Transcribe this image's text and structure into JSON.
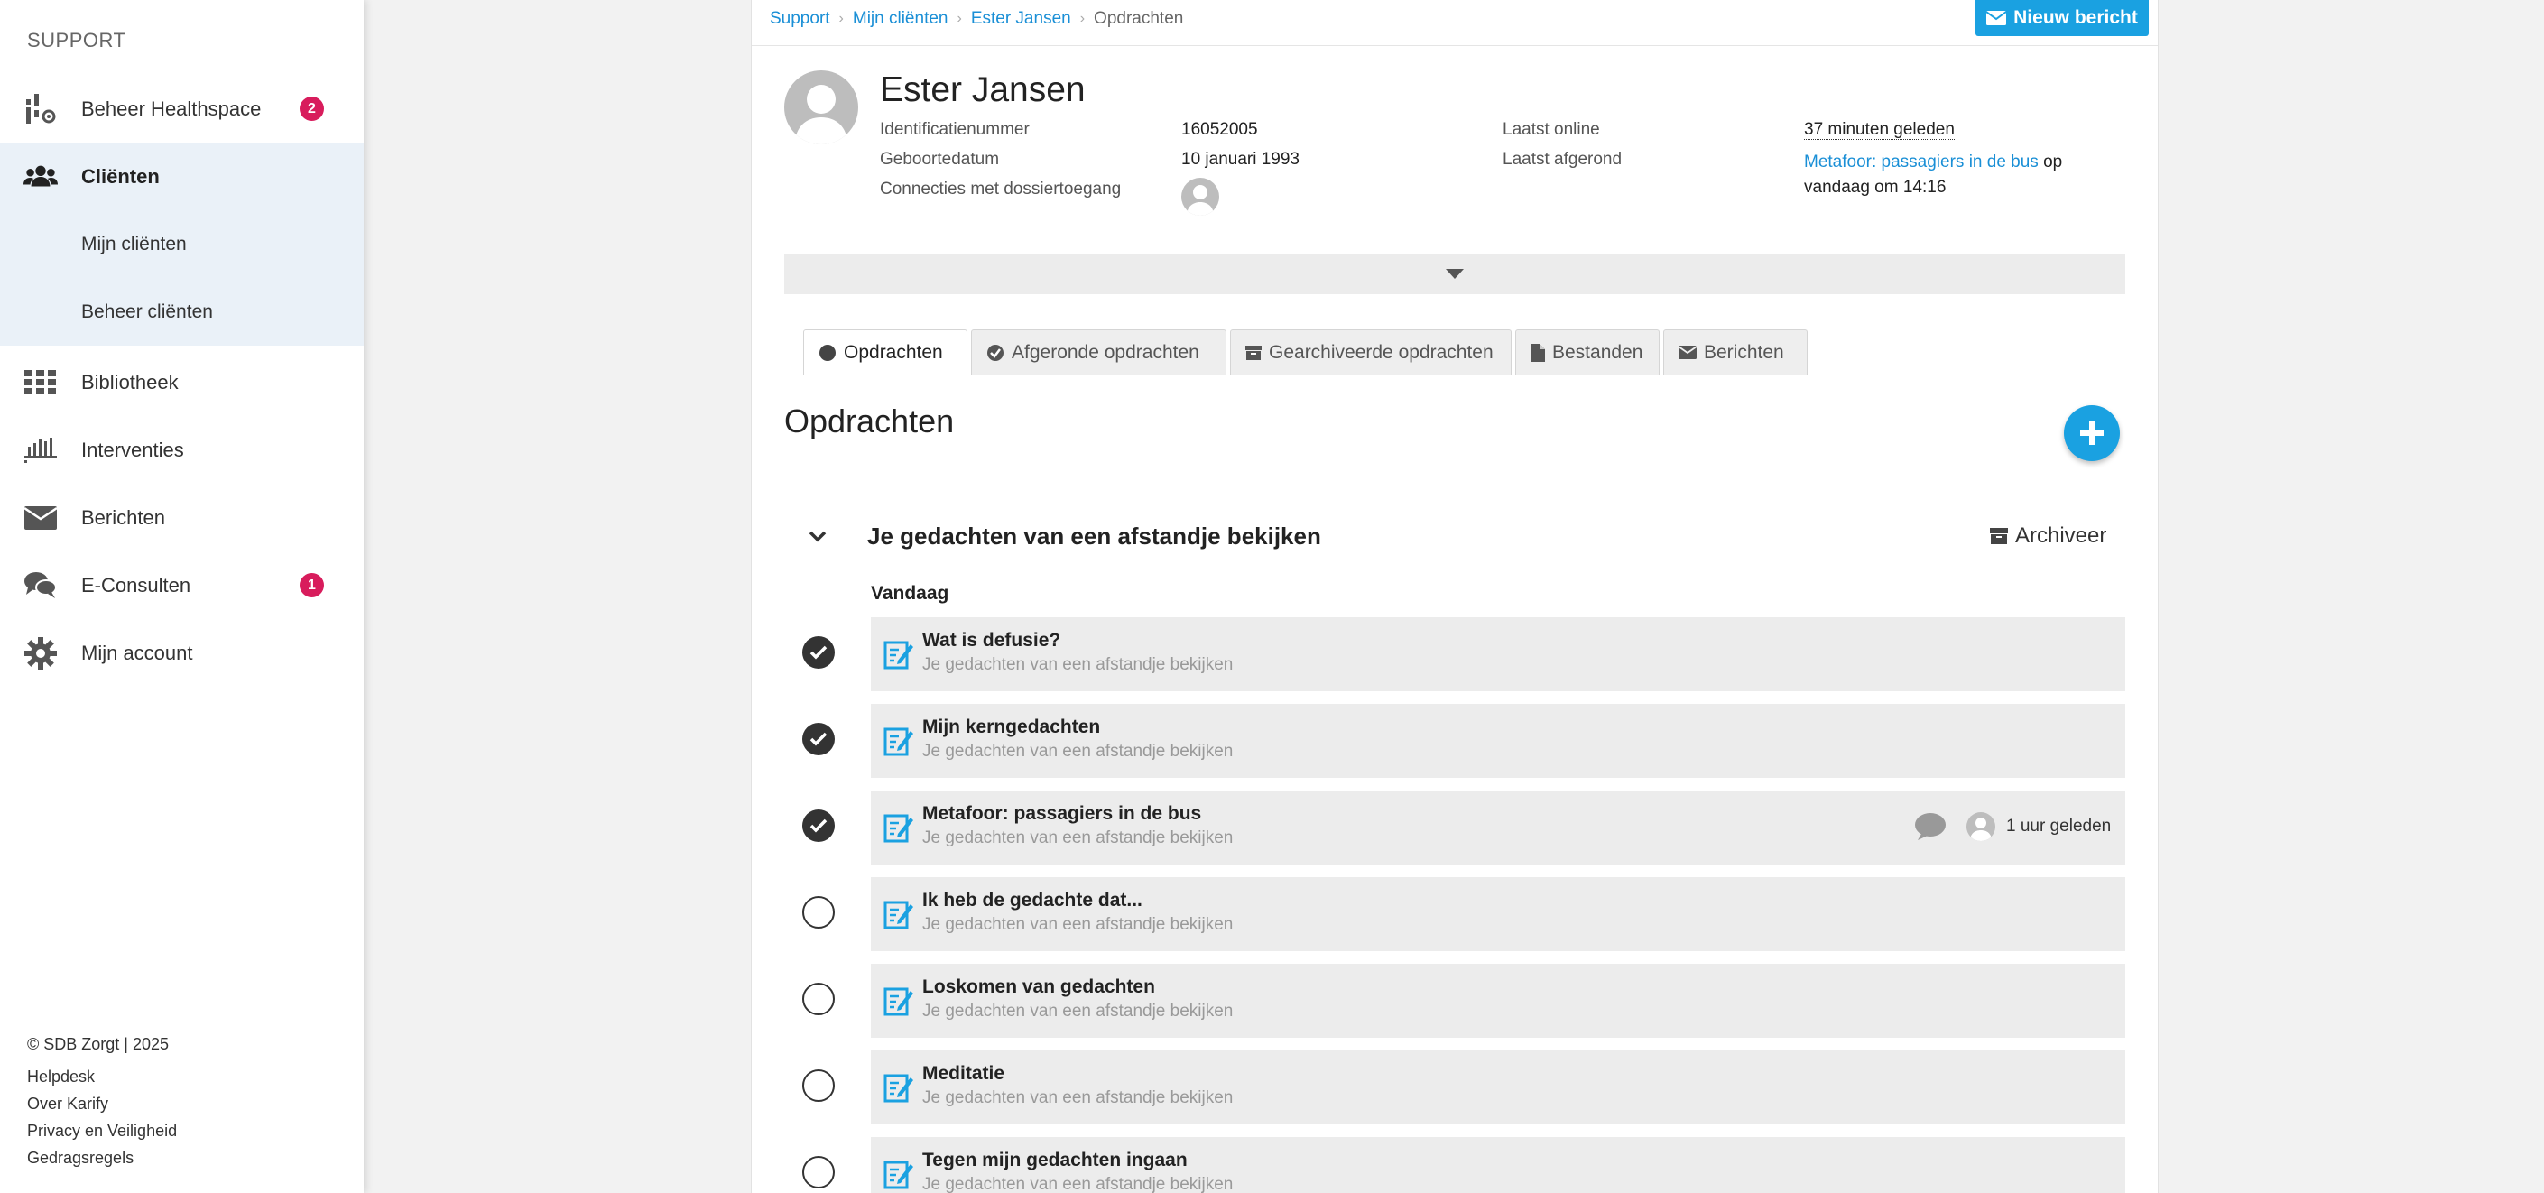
{
  "sidebar": {
    "heading": "SUPPORT",
    "items": [
      {
        "label": "Beheer Healthspace",
        "icon": "healthspace-icon",
        "badge": "2"
      },
      {
        "label": "Cliënten",
        "icon": "users-icon"
      },
      {
        "label": "Bibliotheek",
        "icon": "grid-icon"
      },
      {
        "label": "Interventies",
        "icon": "interventions-icon"
      },
      {
        "label": "Berichten",
        "icon": "envelope-icon"
      },
      {
        "label": "E-Consulten",
        "icon": "chat-icon",
        "badge": "1"
      },
      {
        "label": "Mijn account",
        "icon": "gear-icon"
      }
    ],
    "subitems": [
      "Mijn cliënten",
      "Beheer cliënten"
    ],
    "footer": {
      "copyright": "© SDB Zorgt | 2025",
      "links": [
        "Helpdesk",
        "Over Karify",
        "Privacy en Veiligheid",
        "Gedragsregels"
      ]
    }
  },
  "breadcrumb": [
    "Support",
    "Mijn cliënten",
    "Ester Jansen",
    "Opdrachten"
  ],
  "new_message_label": "Nieuw bericht",
  "client": {
    "name": "Ester Jansen",
    "id_label": "Identificatienummer",
    "id_value": "16052005",
    "birth_label": "Geboortedatum",
    "birth_value": "10 januari 1993",
    "connections_label": "Connecties met dossiertoegang",
    "last_online_label": "Laatst online",
    "last_online_value": "37 minuten geleden",
    "last_done_label": "Laatst afgerond",
    "last_done_link": "Metafoor: passagiers in de bus",
    "last_done_suffix_1": "op",
    "last_done_suffix_2": "vandaag om 14:16"
  },
  "tabs": [
    {
      "label": "Opdrachten",
      "icon": "circle-icon",
      "active": true
    },
    {
      "label": "Afgeronde opdrachten",
      "icon": "check-circle-icon",
      "active": false
    },
    {
      "label": "Gearchiveerde opdrachten",
      "icon": "archive-icon",
      "active": false
    },
    {
      "label": "Bestanden",
      "icon": "file-icon",
      "active": false
    },
    {
      "label": "Berichten",
      "icon": "envelope-icon",
      "active": false
    }
  ],
  "section_title": "Opdrachten",
  "group": {
    "title": "Je gedachten van een afstandje bekijken",
    "archive_label": "Archiveer",
    "day_label": "Vandaag"
  },
  "tasks": [
    {
      "title": "Wat is defusie?",
      "subtitle": "Je gedachten van een afstandje bekijken",
      "done": true
    },
    {
      "title": "Mijn kerngedachten",
      "subtitle": "Je gedachten van een afstandje bekijken",
      "done": true
    },
    {
      "title": "Metafoor: passagiers in de bus",
      "subtitle": "Je gedachten van een afstandje bekijken",
      "done": true,
      "time": "1 uur geleden"
    },
    {
      "title": "Ik heb de gedachte dat...",
      "subtitle": "Je gedachten van een afstandje bekijken",
      "done": false
    },
    {
      "title": "Loskomen van gedachten",
      "subtitle": "Je gedachten van een afstandje bekijken",
      "done": false
    },
    {
      "title": "Meditatie",
      "subtitle": "Je gedachten van een afstandje bekijken",
      "done": false
    },
    {
      "title": "Tegen mijn gedachten ingaan",
      "subtitle": "Je gedachten van een afstandje bekijken",
      "done": false
    }
  ],
  "colors": {
    "accent": "#1aa1e1",
    "badge": "#d81c5c",
    "link": "#1a8fd6",
    "active_bg": "#eaf1f8"
  }
}
